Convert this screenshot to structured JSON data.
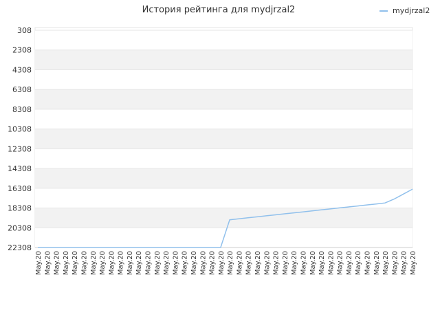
{
  "chart_data": {
    "type": "line",
    "title": "История рейтинга для mydjrzal2",
    "xlabel": "",
    "ylabel": "",
    "y_axis": "inverted",
    "ylim": [
      22308,
      308
    ],
    "yticks": [
      308,
      2308,
      4308,
      6308,
      8308,
      10308,
      12308,
      14308,
      16308,
      18308,
      20308,
      22308
    ],
    "grid": "horizontal alternating bands",
    "legend_position": "top-right",
    "categories": [
      "May.20",
      "May.20",
      "May.20",
      "May.20",
      "May.20",
      "May.20",
      "May.20",
      "May.20",
      "May.20",
      "May.20",
      "May.20",
      "May.20",
      "May.20",
      "May.20",
      "May.20",
      "May.20",
      "May.20",
      "May.20",
      "May.20",
      "May.20",
      "May.20",
      "May.20",
      "May.20",
      "May.20",
      "May.20",
      "May.20",
      "May.20",
      "May.20",
      "May.20",
      "May.20",
      "May.20",
      "May.20",
      "May.20",
      "May.20",
      "May.20",
      "May.20",
      "May.20",
      "May.20",
      "May.20",
      "May.20",
      "May.20",
      "May.20"
    ],
    "series": [
      {
        "name": "mydjrzal2",
        "color": "#90c0ec",
        "values": [
          22308,
          22308,
          22308,
          22308,
          22308,
          22308,
          22308,
          22308,
          22308,
          22308,
          22308,
          22308,
          22308,
          22308,
          22308,
          22308,
          22308,
          22308,
          22308,
          22308,
          22308,
          19500,
          19400,
          19300,
          19200,
          19100,
          19000,
          18900,
          18800,
          18700,
          18600,
          18500,
          18400,
          18300,
          18200,
          18100,
          18000,
          17900,
          17800,
          17400,
          16900,
          16400
        ]
      }
    ]
  }
}
